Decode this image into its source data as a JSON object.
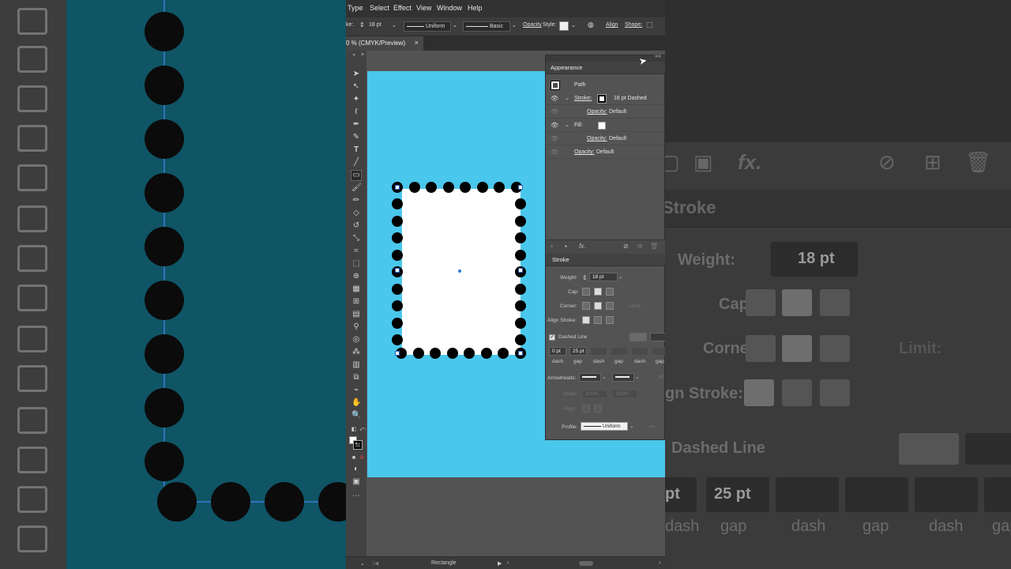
{
  "menu": [
    "Type",
    "Select",
    "Effect",
    "View",
    "Window",
    "Help"
  ],
  "control_bar": {
    "weight_label": "ke:",
    "weight_value": "18 pt",
    "uniform_label": "Uniform",
    "brush_label": "Basic",
    "opacity_label": "Opacity",
    "style_label": "Style:",
    "align_label": "Align",
    "shape_label": "Shape:"
  },
  "doc_tab": {
    "title": "0 % (CMYK/Preview)",
    "close": "×"
  },
  "appearance": {
    "title": "Appearance",
    "object_label": "Path",
    "rows": [
      {
        "label": "Stroke:",
        "value": "18 pt Dashed"
      },
      {
        "label": "Opacity:",
        "value": "Default"
      },
      {
        "label": "Fill:",
        "value": ""
      },
      {
        "label": "Opacity:",
        "value": "Default"
      },
      {
        "label": "Opacity:",
        "value": "Default"
      }
    ],
    "footer_fx": "fx."
  },
  "stroke_panel": {
    "title": "Stroke",
    "weight_label": "Weight:",
    "weight_value": "18 pt",
    "cap_label": "Cap:",
    "corner_label": "Corner:",
    "limit_label": "Limit:",
    "align_label": "Align Stroke:",
    "dashed_label": "Dashed Line",
    "dash_values": [
      "0 pt",
      "25 pt",
      "",
      "",
      "",
      ""
    ],
    "dash_labels": [
      "dash",
      "gap",
      "dash",
      "gap",
      "dash",
      "gap"
    ],
    "arrowheads_label": "Arrowheads:",
    "scale_label": "Scale:",
    "scale_value_1": "100%",
    "scale_value_2": "100%",
    "align_arrows_label": "Align:",
    "profile_label": "Profile:",
    "profile_value": "Uniform"
  },
  "status": {
    "tool_name": "Rectangle"
  },
  "bg_right": {
    "fx": "fx.",
    "stroke_title": "Stroke",
    "weight_label": "Weight:",
    "weight_value": "18 pt",
    "cap_label": "Cap:",
    "corner_label": "Corner:",
    "limit_label": "Limit:",
    "align_label": "gn Stroke:",
    "dashed_label": "Dashed Line",
    "dash_value_1": "pt",
    "dash_value_2": "25 pt",
    "dash_labels": [
      "dash",
      "gap",
      "dash",
      "gap",
      "dash",
      "gap"
    ]
  },
  "colors": {
    "artboard": "#4ac7ec",
    "panel": "#535353",
    "selection": "#2a62c4"
  }
}
